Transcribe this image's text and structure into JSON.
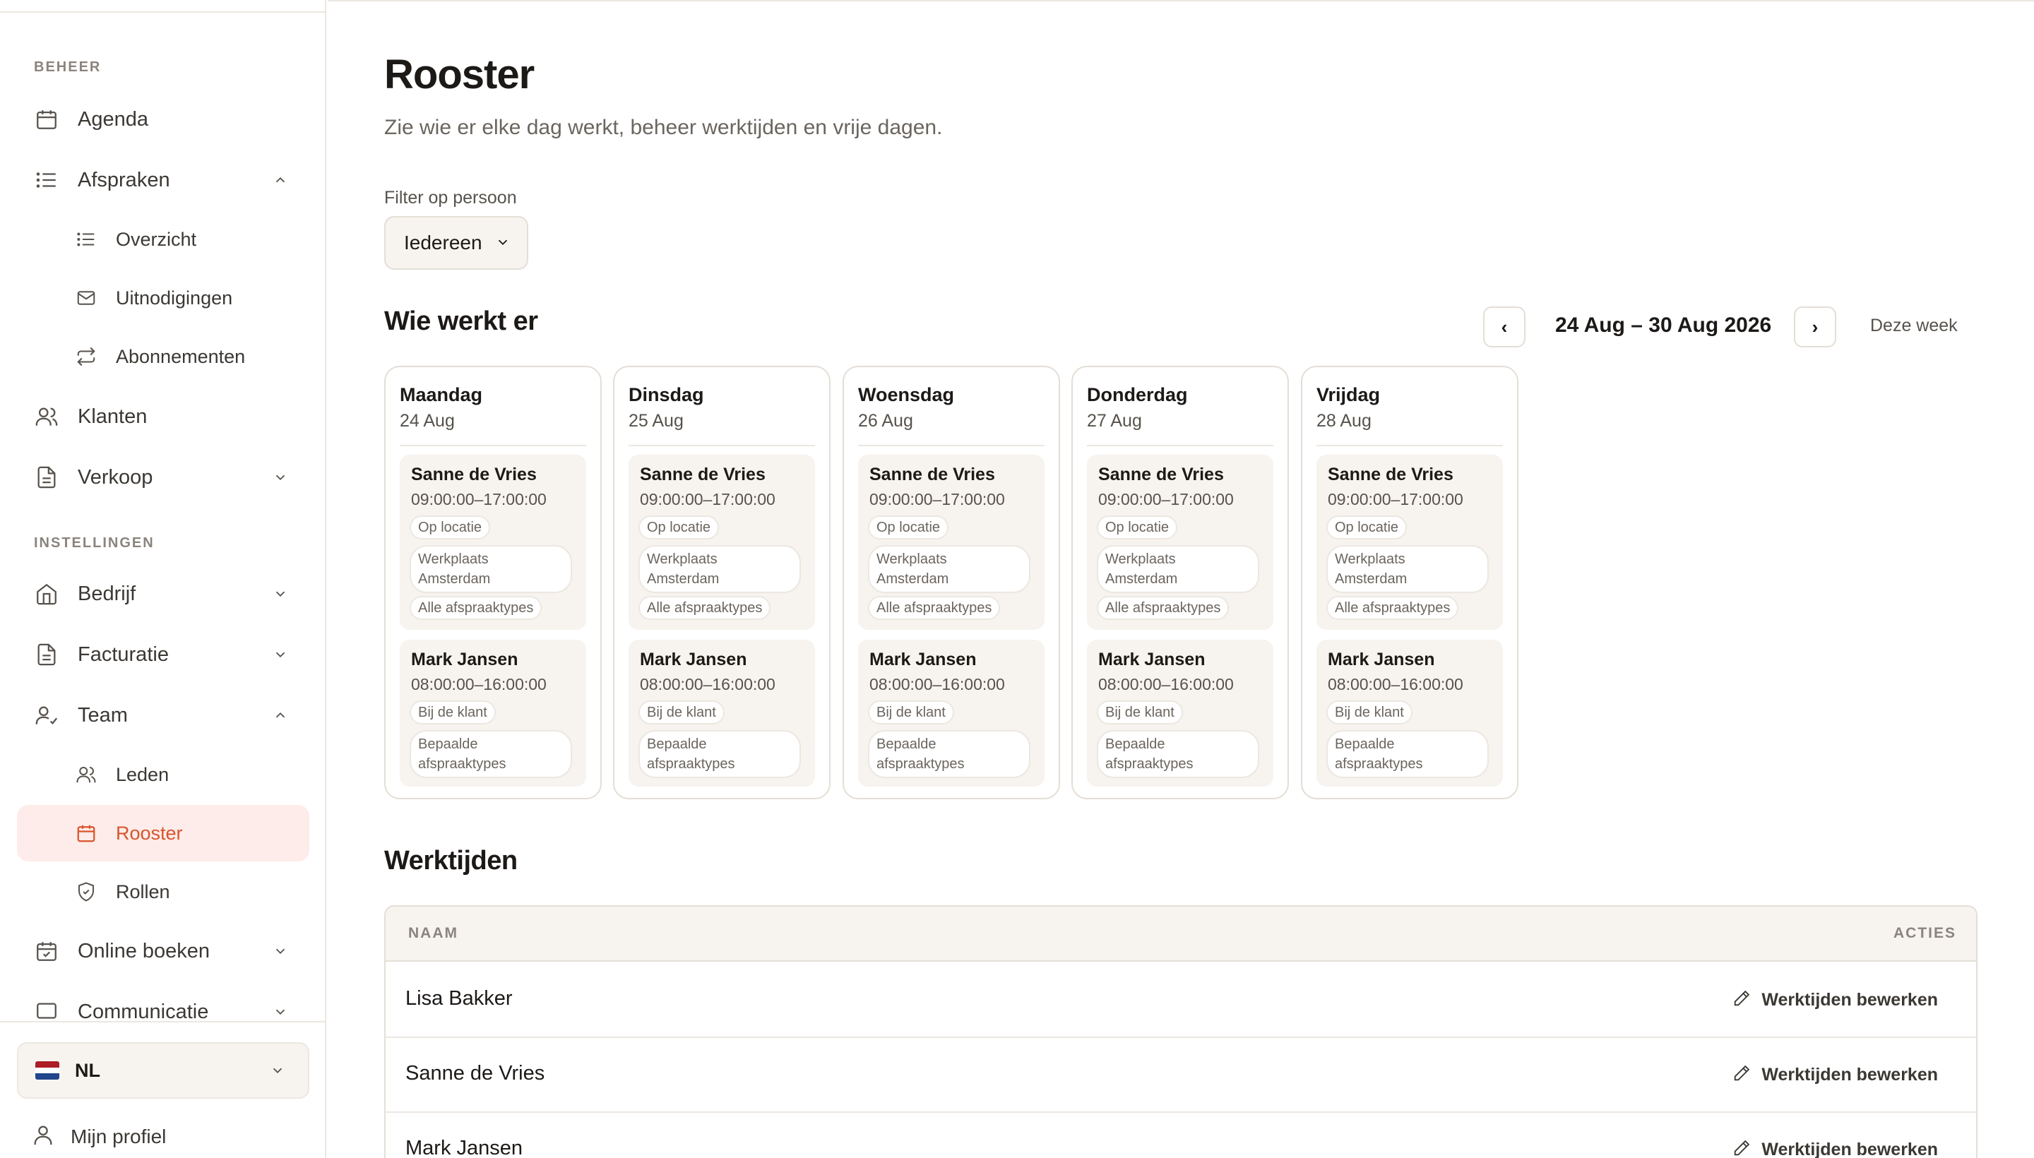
{
  "sidebar": {
    "section_beheer": "BEHEER",
    "section_instellingen": "INSTELLINGEN",
    "items": {
      "agenda": "Agenda",
      "afspraken": "Afspraken",
      "overzicht": "Overzicht",
      "uitnodigingen": "Uitnodigingen",
      "abonnementen": "Abonnementen",
      "klanten": "Klanten",
      "verkoop": "Verkoop",
      "bedrijf": "Bedrijf",
      "facturatie": "Facturatie",
      "team": "Team",
      "leden": "Leden",
      "rooster": "Rooster",
      "rollen": "Rollen",
      "online_boeken": "Online boeken",
      "communicatie": "Communicatie"
    },
    "language": "NL",
    "profile": "Mijn profiel"
  },
  "colors": {
    "accent": "#d9542b",
    "accent_bg": "#fdecea",
    "surface": "#f7f4ef"
  },
  "page": {
    "title": "Rooster",
    "subtitle": "Zie wie er elke dag werkt, beheer werktijden en vrije dagen.",
    "filter_label": "Filter op persoon",
    "filter_value": "Iedereen"
  },
  "schedule": {
    "title": "Wie werkt er",
    "prev": "‹",
    "next": "›",
    "range": "24 Aug – 30 Aug 2026",
    "this_week": "Deze week",
    "days": [
      {
        "name": "Maandag",
        "date": "24 Aug",
        "shifts": [
          {
            "person": "Sanne de Vries",
            "time": "09:00:00–17:00:00",
            "location_type": "Op locatie",
            "location": "Werkplaats Amsterdam",
            "types": "Alle afspraaktypes"
          },
          {
            "person": "Mark Jansen",
            "time": "08:00:00–16:00:00",
            "location_type": "Bij de klant",
            "types": "Bepaalde afspraaktypes"
          }
        ]
      },
      {
        "name": "Dinsdag",
        "date": "25 Aug",
        "shifts": [
          {
            "person": "Sanne de Vries",
            "time": "09:00:00–17:00:00",
            "location_type": "Op locatie",
            "location": "Werkplaats Amsterdam",
            "types": "Alle afspraaktypes"
          },
          {
            "person": "Mark Jansen",
            "time": "08:00:00–16:00:00",
            "location_type": "Bij de klant",
            "types": "Bepaalde afspraaktypes"
          }
        ]
      },
      {
        "name": "Woensdag",
        "date": "26 Aug",
        "shifts": [
          {
            "person": "Sanne de Vries",
            "time": "09:00:00–17:00:00",
            "location_type": "Op locatie",
            "location": "Werkplaats Amsterdam",
            "types": "Alle afspraaktypes"
          },
          {
            "person": "Mark Jansen",
            "time": "08:00:00–16:00:00",
            "location_type": "Bij de klant",
            "types": "Bepaalde afspraaktypes"
          }
        ]
      },
      {
        "name": "Donderdag",
        "date": "27 Aug",
        "shifts": [
          {
            "person": "Sanne de Vries",
            "time": "09:00:00–17:00:00",
            "location_type": "Op locatie",
            "location": "Werkplaats Amsterdam",
            "types": "Alle afspraaktypes"
          },
          {
            "person": "Mark Jansen",
            "time": "08:00:00–16:00:00",
            "location_type": "Bij de klant",
            "types": "Bepaalde afspraaktypes"
          }
        ]
      },
      {
        "name": "Vrijdag",
        "date": "28 Aug",
        "shifts": [
          {
            "person": "Sanne de Vries",
            "time": "09:00:00–17:00:00",
            "location_type": "Op locatie",
            "location": "Werkplaats Amsterdam",
            "types": "Alle afspraaktypes"
          },
          {
            "person": "Mark Jansen",
            "time": "08:00:00–16:00:00",
            "location_type": "Bij de klant",
            "types": "Bepaalde afspraaktypes"
          }
        ]
      }
    ]
  },
  "werktijden": {
    "title": "Werktijden",
    "col_name": "NAAM",
    "col_actions": "ACTIES",
    "edit_label": "Werktijden bewerken",
    "rows": [
      {
        "name": "Lisa Bakker"
      },
      {
        "name": "Sanne de Vries"
      },
      {
        "name": "Mark Jansen"
      }
    ]
  }
}
